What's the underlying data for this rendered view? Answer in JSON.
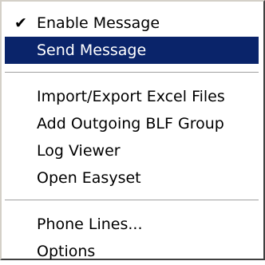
{
  "menu": {
    "groups": [
      {
        "items": [
          {
            "label": "Enable Message",
            "checked": true,
            "highlighted": false
          },
          {
            "label": "Send Message",
            "checked": false,
            "highlighted": true
          }
        ]
      },
      {
        "items": [
          {
            "label": "Import/Export Excel Files"
          },
          {
            "label": "Add Outgoing BLF Group"
          },
          {
            "label": "Log Viewer"
          },
          {
            "label": "Open Easyset"
          }
        ]
      },
      {
        "items": [
          {
            "label": "Phone Lines..."
          },
          {
            "label": "Options"
          }
        ]
      }
    ],
    "check_glyph": "✔",
    "colors": {
      "highlight_bg": "#0a246a",
      "highlight_text": "#ffffff",
      "menu_bg": "#ffffff",
      "text": "#000000"
    }
  }
}
